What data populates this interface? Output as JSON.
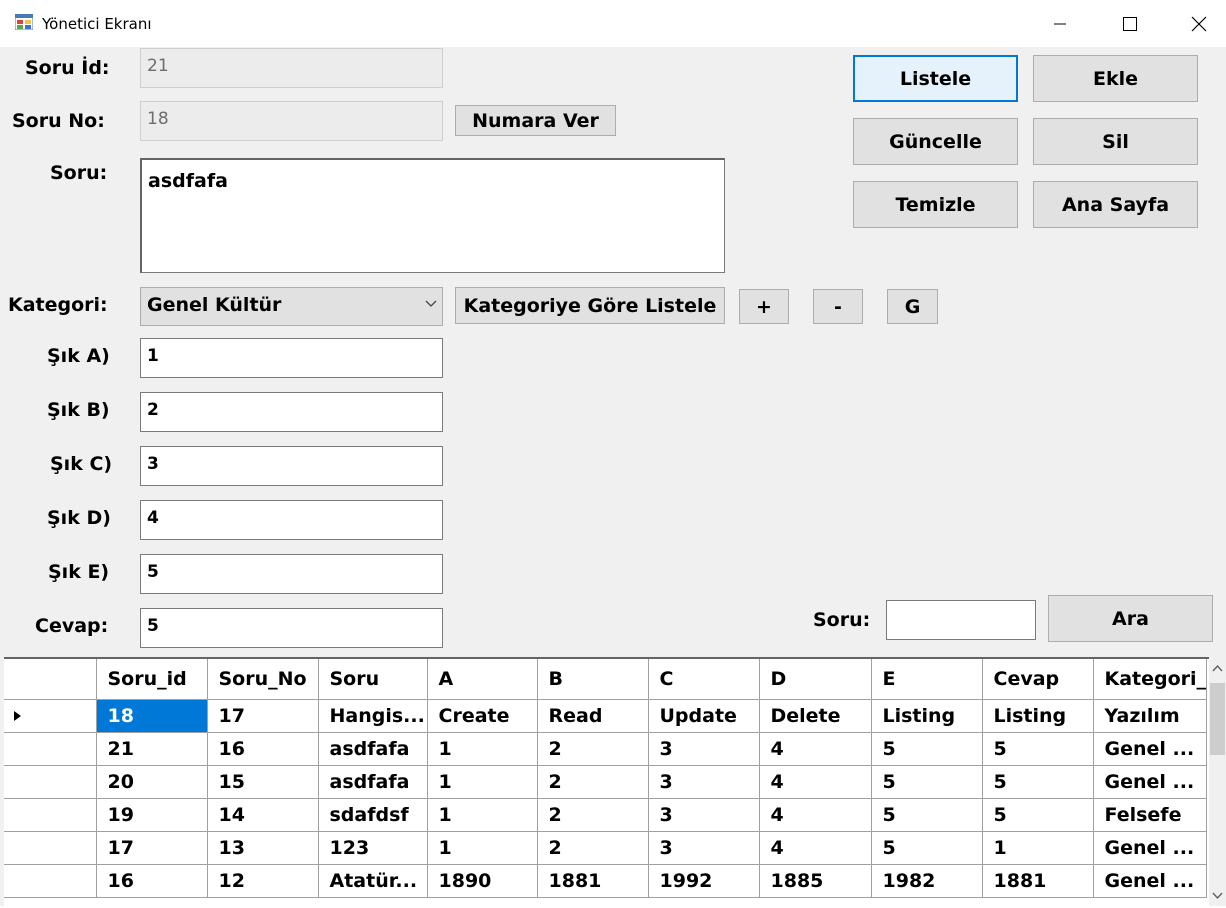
{
  "window": {
    "title": "Yönetici Ekranı"
  },
  "form": {
    "soru_id_label": "Soru İd:",
    "soru_id_value": "21",
    "soru_no_label": "Soru No:",
    "soru_no_value": "18",
    "numara_ver_label": "Numara Ver",
    "soru_label": "Soru:",
    "soru_value": "asdfafa",
    "kategori_label": "Kategori:",
    "kategori_value": "Genel Kültür",
    "kategori_listele_label": "Kategoriye Göre Listele",
    "plus_label": "+",
    "minus_label": "-",
    "g_label": "G",
    "sik_a_label": "Şık A)",
    "sik_a_value": "1",
    "sik_b_label": "Şık B)",
    "sik_b_value": "2",
    "sik_c_label": "Şık C)",
    "sik_c_value": "3",
    "sik_d_label": "Şık D)",
    "sik_d_value": "4",
    "sik_e_label": "Şık E)",
    "sik_e_value": "5",
    "cevap_label": "Cevap:",
    "cevap_value": "5"
  },
  "actions": {
    "listele": "Listele",
    "ekle": "Ekle",
    "guncelle": "Güncelle",
    "sil": "Sil",
    "temizle": "Temizle",
    "ana_sayfa": "Ana Sayfa"
  },
  "search": {
    "label": "Soru:",
    "value": "",
    "button": "Ara"
  },
  "grid": {
    "columns": [
      "Soru_id",
      "Soru_No",
      "Soru",
      "A",
      "B",
      "C",
      "D",
      "E",
      "Cevap",
      "Kategori_"
    ],
    "rows": [
      [
        "18",
        "17",
        "Hangis...",
        "Create",
        "Read",
        "Update",
        "Delete",
        "Listing",
        "Listing",
        "Yazılım"
      ],
      [
        "21",
        "16",
        "asdfafa",
        "1",
        "2",
        "3",
        "4",
        "5",
        "5",
        "Genel ..."
      ],
      [
        "20",
        "15",
        "asdfafa",
        "1",
        "2",
        "3",
        "4",
        "5",
        "5",
        "Genel ..."
      ],
      [
        "19",
        "14",
        "sdafdsf",
        "1",
        "2",
        "3",
        "4",
        "5",
        "5",
        "Felsefe"
      ],
      [
        "17",
        "13",
        "123",
        "1",
        "2",
        "3",
        "4",
        "5",
        "1",
        "Genel ..."
      ],
      [
        "16",
        "12",
        "Atatür...",
        "1890",
        "1881",
        "1992",
        "1885",
        "1982",
        "1881",
        "Genel ..."
      ]
    ]
  }
}
